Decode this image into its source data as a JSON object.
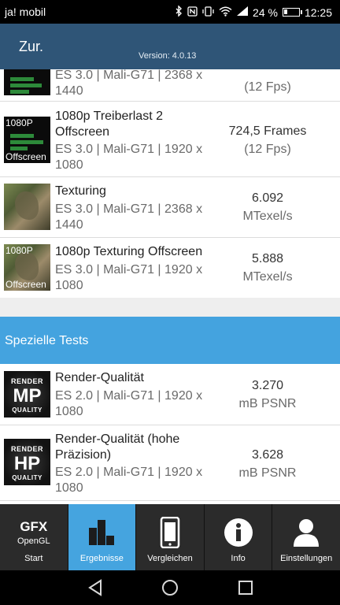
{
  "status_bar": {
    "carrier": "ja! mobil",
    "battery_percent": "24 %",
    "battery_level": 0.24,
    "time": "12:25",
    "icons": [
      "bluetooth-icon",
      "nfc-icon",
      "vibrate-icon",
      "wifi-icon",
      "signal-icon",
      "battery-icon"
    ]
  },
  "header": {
    "back_label": "Zur.",
    "version": "Version: 4.0.13",
    "background": "#2f5577"
  },
  "rows": [
    {
      "name": "",
      "sub": "ES 3.0 | Mali-G71 | 2368 x 1440",
      "value": "",
      "unit": "(12 Fps)",
      "thumb": "chart"
    },
    {
      "name": "1080p Treiberlast 2 Offscreen",
      "sub": "ES 3.0 | Mali-G71 | 1920 x 1080",
      "value": "724,5 Frames",
      "unit": "(12 Fps)",
      "thumb": "chart",
      "badge_top": "1080P",
      "badge_bottom": "Offscreen"
    },
    {
      "name": "Texturing",
      "sub": "ES 3.0 | Mali-G71 | 2368 x 1440",
      "value": "6.092",
      "unit": "MTexel/s",
      "thumb": "texture"
    },
    {
      "name": "1080p Texturing Offscreen",
      "sub": "ES 3.0 | Mali-G71 | 1920 x 1080",
      "value": "5.888",
      "unit": "MTexel/s",
      "thumb": "texture",
      "badge_top": "1080P",
      "badge_bottom": "Offscreen"
    }
  ],
  "section": {
    "title": "Spezielle Tests",
    "color": "#44a3df"
  },
  "special_rows": [
    {
      "name": "Render-Qualität",
      "sub": "ES 2.0 | Mali-G71 | 1920 x 1080",
      "value": "3.270",
      "unit": "mB PSNR",
      "badge_top": "RENDER",
      "badge_mid": "MP",
      "badge_bottom": "QUALITY"
    },
    {
      "name": "Render-Qualität (hohe Präzision)",
      "sub": "ES 2.0 | Mali-G71 | 1920 x 1080",
      "value": "3.628",
      "unit": "mB PSNR",
      "badge_top": "RENDER",
      "badge_mid": "HP",
      "badge_bottom": "QUALITY"
    }
  ],
  "tabs": [
    {
      "label": "Start",
      "logo_top": "GFX",
      "logo_bottom": "OpenGL",
      "icon": "gfx-logo",
      "active": false
    },
    {
      "label": "Ergebnisse",
      "icon": "bar-chart-icon",
      "active": true
    },
    {
      "label": "Vergleichen",
      "icon": "phone-icon",
      "active": false
    },
    {
      "label": "Info",
      "icon": "info-icon",
      "active": false
    },
    {
      "label": "Einstellungen",
      "icon": "user-icon",
      "active": false
    }
  ],
  "nav_icons": [
    "back-triangle-icon",
    "home-circle-icon",
    "recents-square-icon"
  ],
  "accent_color": "#45a4df"
}
